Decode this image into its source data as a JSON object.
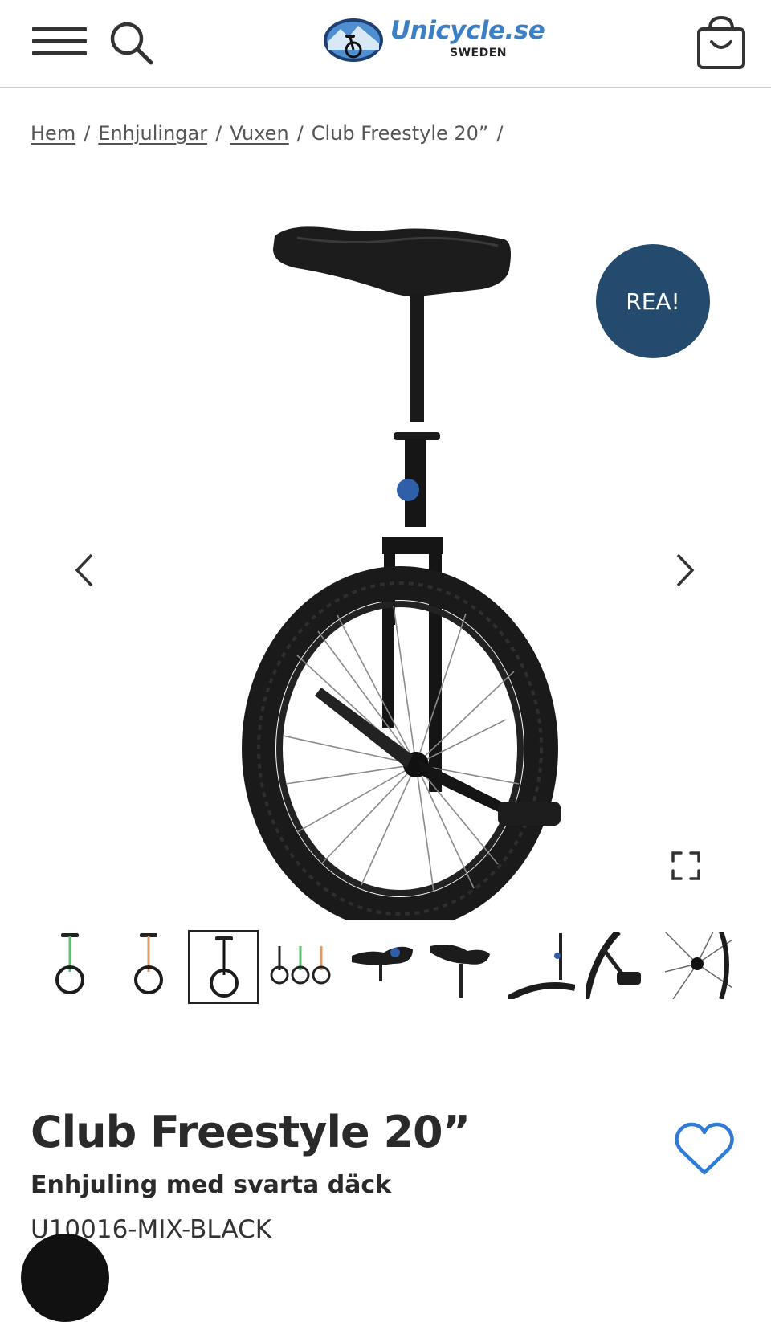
{
  "header": {
    "menu_icon": "hamburger-menu-icon",
    "search_icon": "search-icon",
    "logo_text": "Unicycle.se",
    "logo_subtext": "SWEDEN",
    "cart_icon": "shopping-bag-icon"
  },
  "breadcrumb": {
    "items": [
      "Hem",
      "Enhjulingar",
      "Vuxen"
    ],
    "current": "Club Freestyle 20”",
    "separator": "/"
  },
  "gallery": {
    "sale_badge": "REA!",
    "prev_icon": "chevron-left-icon",
    "next_icon": "chevron-right-icon",
    "fullscreen_icon": "fullscreen-icon",
    "thumbnail_count": 9,
    "active_thumbnail": 3
  },
  "product": {
    "title": "Club Freestyle 20”",
    "subtitle": "Enhjuling med svarta däck",
    "sku": "U10016-MIX-BLACK",
    "wishlist_icon": "heart-icon"
  },
  "colors": {
    "brand_blue": "#3c7fc4",
    "badge_navy": "#244a6e",
    "heart_blue": "#2f7bd6"
  }
}
